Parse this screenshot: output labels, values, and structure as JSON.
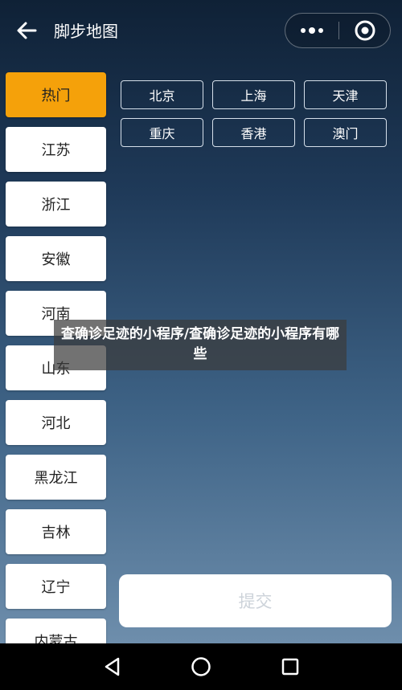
{
  "header": {
    "title": "脚步地图",
    "icons": {
      "back": "arrow-left-icon",
      "more": "more-dots-icon",
      "close": "target-circle-icon"
    }
  },
  "provinces": [
    {
      "label": "热门",
      "active": true
    },
    {
      "label": "江苏",
      "active": false
    },
    {
      "label": "浙江",
      "active": false
    },
    {
      "label": "安徽",
      "active": false
    },
    {
      "label": "河南",
      "active": false
    },
    {
      "label": "山东",
      "active": false
    },
    {
      "label": "河北",
      "active": false
    },
    {
      "label": "黑龙江",
      "active": false
    },
    {
      "label": "吉林",
      "active": false
    },
    {
      "label": "辽宁",
      "active": false
    },
    {
      "label": "内蒙古",
      "active": false
    }
  ],
  "cities": [
    "北京",
    "上海",
    "天津",
    "重庆",
    "香港",
    "澳门"
  ],
  "submit": {
    "label": "提交"
  },
  "overlay": {
    "text": "查确诊足迹的小程序/查确诊足迹的小程序有哪些"
  },
  "navbar": {
    "icons": [
      "back-triangle-icon",
      "home-circle-icon",
      "recents-square-icon"
    ]
  },
  "colors": {
    "active": "#f5a10a",
    "city_border": "#d5dfea"
  }
}
